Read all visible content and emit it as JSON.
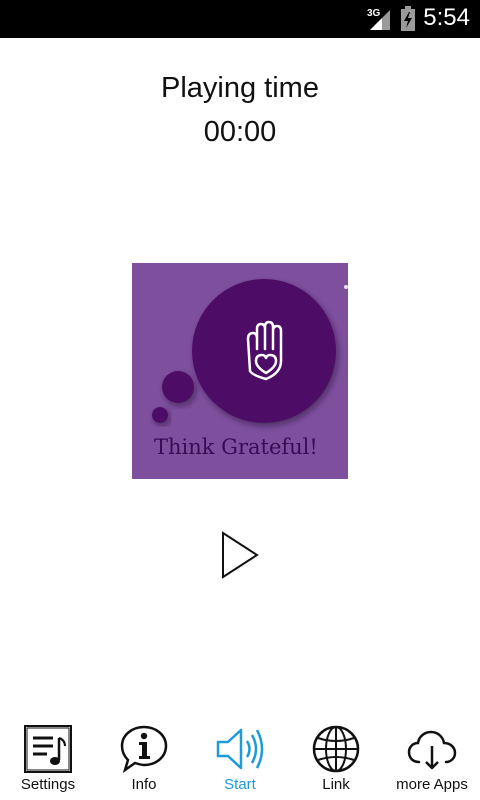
{
  "status_bar": {
    "time": "5:54",
    "network": "3G"
  },
  "player": {
    "title": "Playing time",
    "elapsed": "00:00",
    "artwork_caption": "Think Grateful!"
  },
  "nav": {
    "items": [
      {
        "label": "Settings",
        "icon": "settings-music-icon"
      },
      {
        "label": "Info",
        "icon": "info-icon"
      },
      {
        "label": "Start",
        "icon": "speaker-icon",
        "active": true
      },
      {
        "label": "Link",
        "icon": "globe-icon"
      },
      {
        "label": "more Apps",
        "icon": "cloud-download-icon"
      }
    ]
  },
  "colors": {
    "accent": "#1e9ad6",
    "artwork_bg": "#7d4f9d",
    "artwork_circle": "#4e0b66"
  }
}
